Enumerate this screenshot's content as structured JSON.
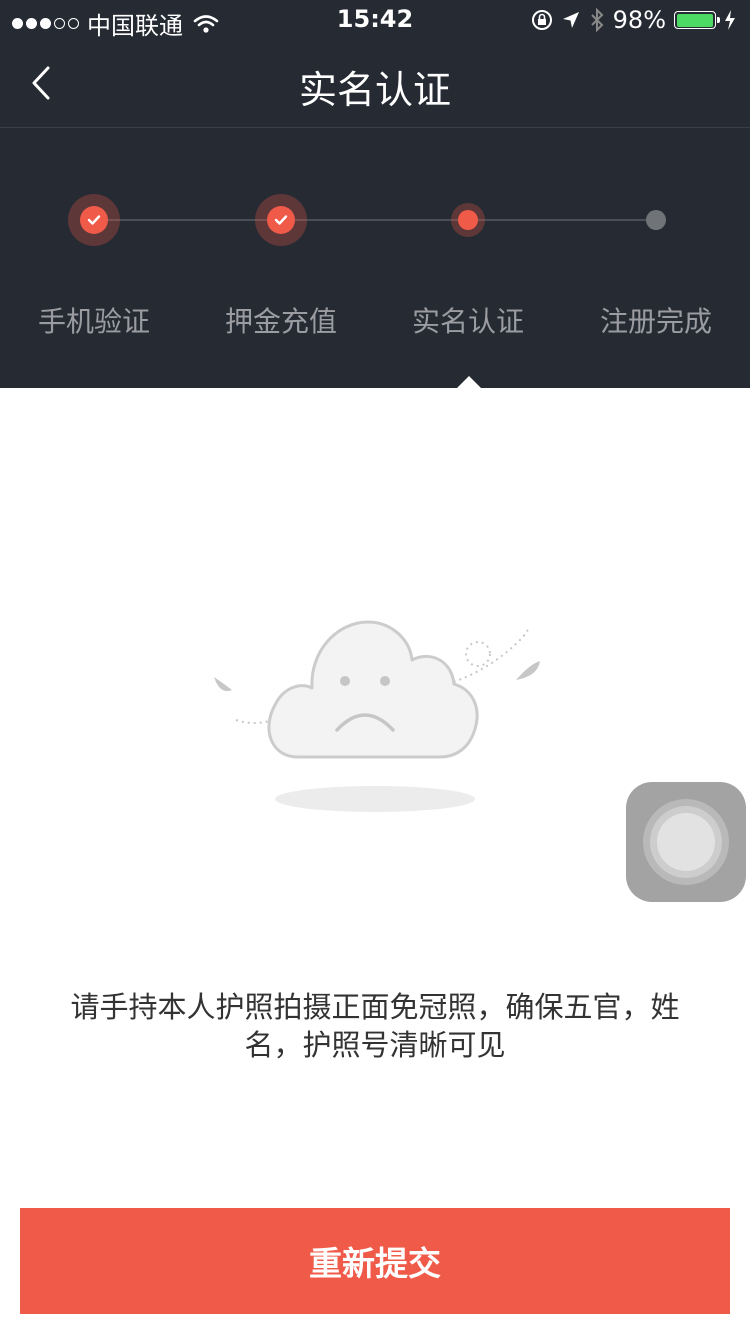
{
  "status_bar": {
    "carrier": "中国联通",
    "time": "15:42",
    "battery_percent": "98%",
    "battery_level": 0.98,
    "icons": [
      "signal-dots-icon",
      "wifi-icon",
      "rotation-lock-icon",
      "location-arrow-icon",
      "bluetooth-icon",
      "battery-icon",
      "charging-bolt-icon"
    ]
  },
  "nav": {
    "title": "实名认证",
    "back_icon": "chevron-left-icon"
  },
  "steps": {
    "current_index": 2,
    "items": [
      {
        "label": "手机验证",
        "state": "done"
      },
      {
        "label": "押金充值",
        "state": "done"
      },
      {
        "label": "实名认证",
        "state": "current"
      },
      {
        "label": "注册完成",
        "state": "pending"
      }
    ]
  },
  "illustration": {
    "icon": "sad-cloud-icon"
  },
  "instruction": {
    "line1": "请手持本人护照拍摄正面免冠照，确保五官，姓",
    "line2": "名，护照号清晰可见"
  },
  "submit": {
    "label": "重新提交"
  },
  "colors": {
    "header_bg": "#262a33",
    "accent": "#f05a48",
    "step_label": "#9a9ca1",
    "body_text": "#333333"
  }
}
